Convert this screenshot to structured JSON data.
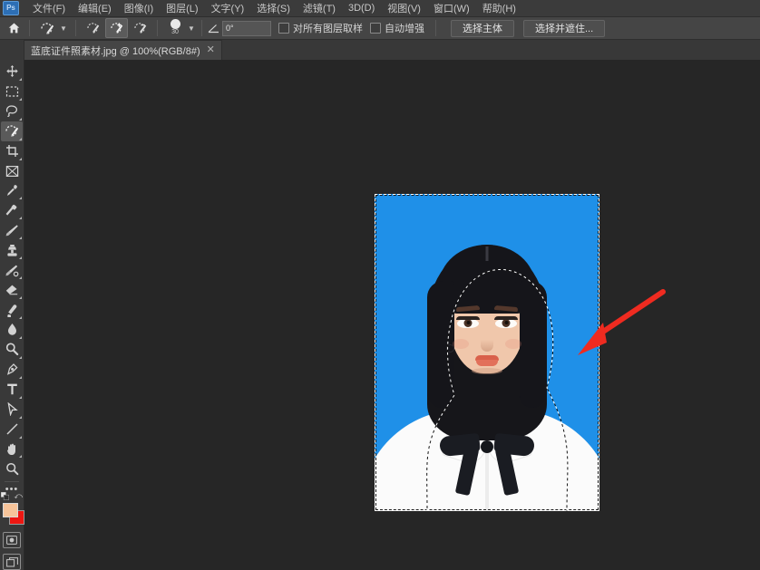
{
  "app": {
    "name": "Adobe Photoshop",
    "logo_text": "Ps",
    "theme_bg": "#323232",
    "canvas_bg": "#262626"
  },
  "menubar": {
    "items": [
      {
        "label": "文件(F)",
        "name": "menu-file"
      },
      {
        "label": "编辑(E)",
        "name": "menu-edit"
      },
      {
        "label": "图像(I)",
        "name": "menu-image"
      },
      {
        "label": "图层(L)",
        "name": "menu-layer"
      },
      {
        "label": "文字(Y)",
        "name": "menu-type"
      },
      {
        "label": "选择(S)",
        "name": "menu-select"
      },
      {
        "label": "滤镜(T)",
        "name": "menu-filter"
      },
      {
        "label": "3D(D)",
        "name": "menu-3d"
      },
      {
        "label": "视图(V)",
        "name": "menu-view"
      },
      {
        "label": "窗口(W)",
        "name": "menu-window"
      },
      {
        "label": "帮助(H)",
        "name": "menu-help"
      }
    ]
  },
  "options_bar": {
    "home_icon": "home-icon",
    "tool_preset_icon": "quick-selection-tool-icon",
    "preset_chevron": "chevron-down-icon",
    "selection_modes": [
      {
        "name": "new-selection-button",
        "icon": "quick-selection-new-icon",
        "active": false
      },
      {
        "name": "add-to-selection-button",
        "icon": "quick-selection-add-icon",
        "active": true
      },
      {
        "name": "subtract-from-selection-button",
        "icon": "quick-selection-subtract-icon",
        "active": false
      }
    ],
    "brush_size": "30",
    "brush_chevron": "chevron-down-icon",
    "angle_icon": "angle-icon",
    "angle_value": "0°",
    "checkbox_sample_all_layers": "对所有图层取样",
    "checkbox_auto_enhance": "自动增强",
    "button_select_subject": "选择主体",
    "button_select_and_mask": "选择并遮住..."
  },
  "tab_bar": {
    "document_tab": {
      "label": "蓝底证件照素材.jpg @ 100%(RGB/8#)",
      "close_icon": "close-icon"
    }
  },
  "toolbar": {
    "tools": [
      {
        "name": "move-tool",
        "icon": "move-icon",
        "active": false,
        "has_flyout": true
      },
      {
        "name": "rectangular-marquee-tool",
        "icon": "marquee-icon",
        "active": false,
        "has_flyout": true
      },
      {
        "name": "lasso-tool",
        "icon": "lasso-icon",
        "active": false,
        "has_flyout": true
      },
      {
        "name": "quick-selection-tool",
        "icon": "quick-selection-icon",
        "active": true,
        "has_flyout": true
      },
      {
        "name": "crop-tool",
        "icon": "crop-icon",
        "active": false,
        "has_flyout": true
      },
      {
        "name": "frame-tool",
        "icon": "frame-icon",
        "active": false,
        "has_flyout": false
      },
      {
        "name": "eyedropper-tool",
        "icon": "eyedropper-icon",
        "active": false,
        "has_flyout": true
      },
      {
        "name": "spot-healing-brush-tool",
        "icon": "healing-brush-icon",
        "active": false,
        "has_flyout": true
      },
      {
        "name": "brush-tool",
        "icon": "brush-icon",
        "active": false,
        "has_flyout": true
      },
      {
        "name": "clone-stamp-tool",
        "icon": "clone-stamp-icon",
        "active": false,
        "has_flyout": true
      },
      {
        "name": "history-brush-tool",
        "icon": "history-brush-icon",
        "active": false,
        "has_flyout": true
      },
      {
        "name": "eraser-tool",
        "icon": "eraser-icon",
        "active": false,
        "has_flyout": true
      },
      {
        "name": "gradient-tool",
        "icon": "gradient-icon",
        "active": false,
        "has_flyout": true
      },
      {
        "name": "blur-tool",
        "icon": "blur-droplet-icon",
        "active": false,
        "has_flyout": true
      },
      {
        "name": "dodge-tool",
        "icon": "dodge-icon",
        "active": false,
        "has_flyout": true
      },
      {
        "name": "pen-tool",
        "icon": "pen-icon",
        "active": false,
        "has_flyout": true
      },
      {
        "name": "type-tool",
        "icon": "type-icon",
        "active": false,
        "has_flyout": true
      },
      {
        "name": "path-selection-tool",
        "icon": "path-arrow-icon",
        "active": false,
        "has_flyout": true
      },
      {
        "name": "line-tool",
        "icon": "line-icon",
        "active": false,
        "has_flyout": true
      },
      {
        "name": "hand-tool",
        "icon": "hand-icon",
        "active": false,
        "has_flyout": true
      },
      {
        "name": "zoom-tool",
        "icon": "magnifier-icon",
        "active": false,
        "has_flyout": false
      },
      {
        "name": "edit-toolbar-button",
        "icon": "ellipsis-icon",
        "active": false,
        "has_flyout": false
      }
    ],
    "colors": {
      "foreground": "#f7c49a",
      "background": "#ee1712",
      "default_colors_icon": "default-colors-icon",
      "swap_colors_icon": "swap-colors-icon"
    },
    "quick_mask_icon": "quick-mask-icon",
    "screen_mode_icon": "screen-mode-icon"
  },
  "canvas": {
    "photo": {
      "background_color": "#1f90e8",
      "shirt_color": "#fbfbfb",
      "bowtie_color": "#1a1c22",
      "hair_color": "#15151a",
      "skin_color": "#f0c7ab",
      "selection_active": true,
      "selection_style": "marching-ants"
    },
    "annotation": {
      "type": "arrow",
      "color": "#ef2b20",
      "points_to": "selection-edge"
    }
  }
}
